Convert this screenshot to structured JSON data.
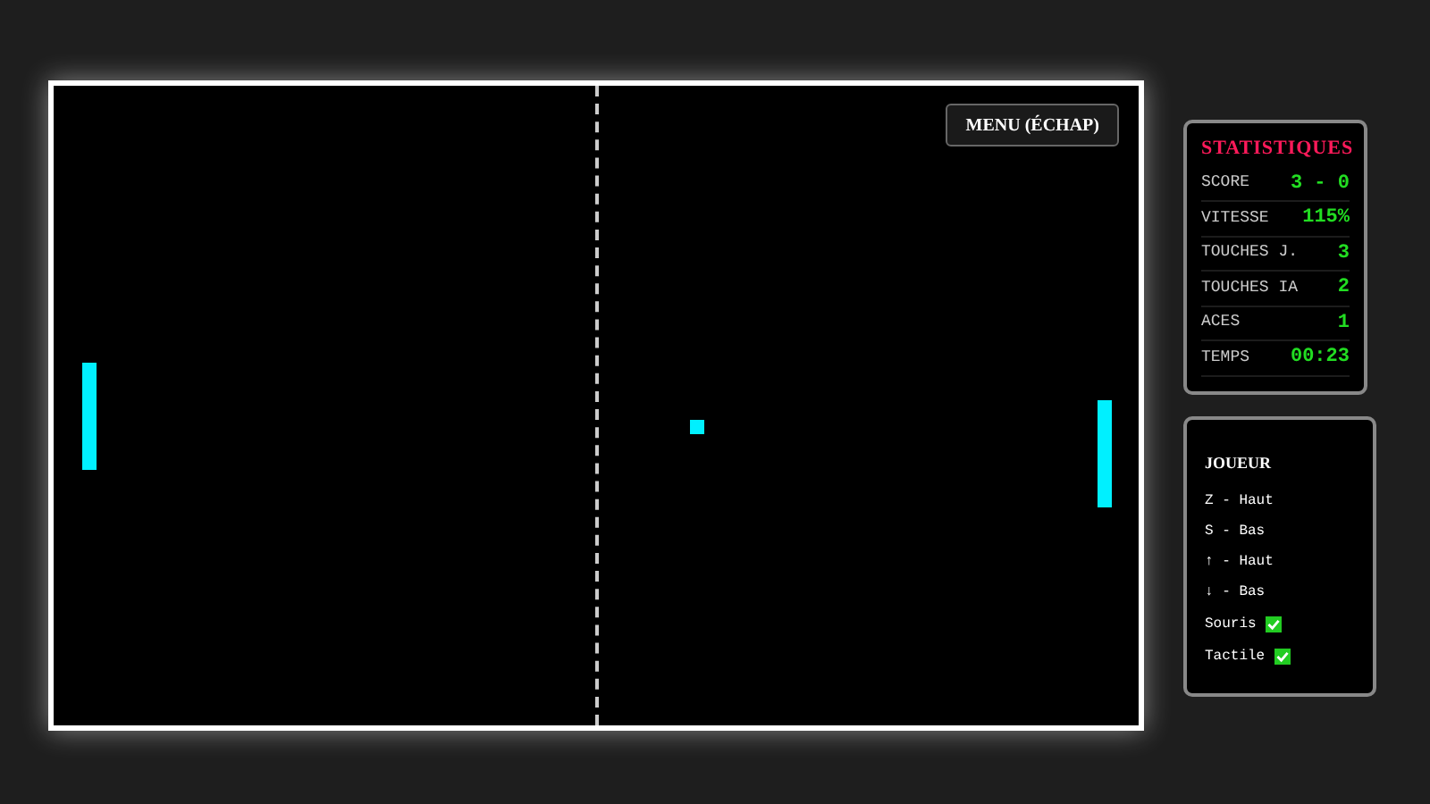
{
  "game": {
    "menu_button": "MENU (ÉCHAP)"
  },
  "stats": {
    "title": "STATISTIQUES",
    "rows": [
      {
        "label": "SCORE",
        "value": "3 - 0"
      },
      {
        "label": "VITESSE",
        "value": "115%"
      },
      {
        "label": "TOUCHES J.",
        "value": "3"
      },
      {
        "label": "TOUCHES IA",
        "value": "2"
      },
      {
        "label": "ACES",
        "value": "1"
      },
      {
        "label": "TEMPS",
        "value": "00:23"
      }
    ]
  },
  "controls": {
    "title": "JOUEUR",
    "items": [
      {
        "kind": "key",
        "text": "Z - Haut"
      },
      {
        "kind": "key",
        "text": "S - Bas"
      },
      {
        "kind": "key",
        "text": "↑ - Haut"
      },
      {
        "kind": "key",
        "text": "↓ - Bas"
      },
      {
        "kind": "toggle",
        "text": "Souris",
        "checked": true
      },
      {
        "kind": "toggle",
        "text": "Tactile",
        "checked": true
      }
    ]
  }
}
